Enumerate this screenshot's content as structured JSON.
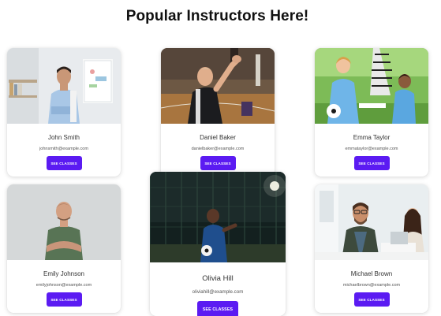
{
  "page": {
    "title": "Popular Instructors Here!"
  },
  "instructors": [
    {
      "name": "John Smith",
      "email": "johnsmith@example.com",
      "button": "SEE CLASSES",
      "photo": "teacher-in-office-photo"
    },
    {
      "name": "Daniel Baker",
      "email": "danielbaker@example.com",
      "button": "SEE CLASSES",
      "photo": "boy-in-gym-photo"
    },
    {
      "name": "Emma Taylor",
      "email": "emmataylor@example.com",
      "button": "SEE CLASSES",
      "photo": "girls-soccer-photo"
    },
    {
      "name": "Emily Johnson",
      "email": "emilyjohnson@example.com",
      "button": "SEE CLASSES",
      "photo": "man-green-shirt-photo"
    },
    {
      "name": "Olivia Hill",
      "email": "oliviahill@example.com",
      "button": "SEE CLASSES",
      "photo": "night-soccer-photo"
    },
    {
      "name": "Michael Brown",
      "email": "michaelbrown@example.com",
      "button": "SEE CLASSES",
      "photo": "office-meeting-photo"
    }
  ],
  "colors": {
    "button": "#5b1bf2",
    "title": "#111111"
  }
}
